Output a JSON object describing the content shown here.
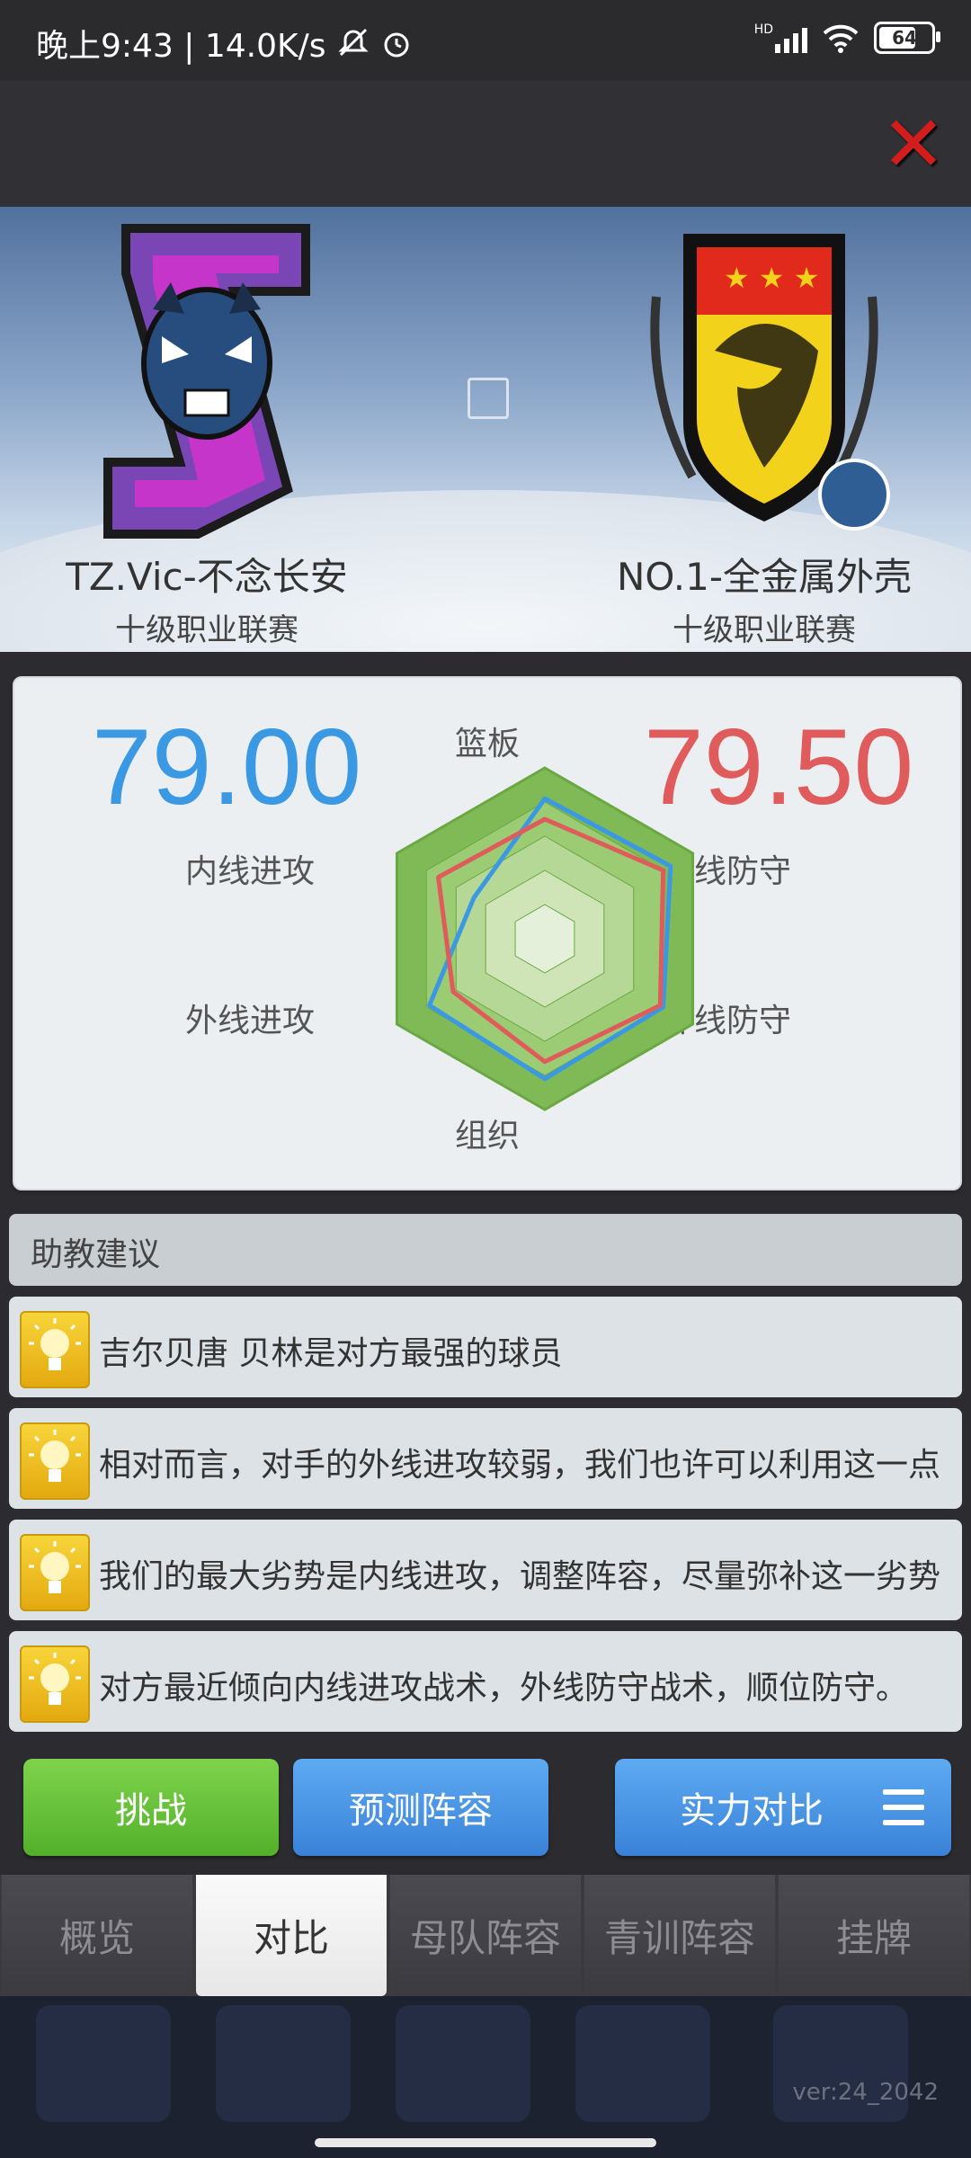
{
  "status_bar": {
    "time_speed": "晚上9:43 | 14.0K/s",
    "network": "HD",
    "battery": "64"
  },
  "header": {
    "close_icon": "close-x-icon"
  },
  "home_team": {
    "name": "TZ.Vic-不念长安",
    "league": "十级职业联赛",
    "score": "79.00",
    "color": "#3b98e3"
  },
  "away_team": {
    "name": "NO.1-全金属外壳",
    "league": "十级职业联赛",
    "score": "79.50",
    "color": "#e05b5b"
  },
  "radar": {
    "axes": [
      "篮板",
      "内线防守",
      "外线防守",
      "组织",
      "外线进攻",
      "内线进攻"
    ],
    "home_values": [
      0.82,
      0.85,
      0.8,
      0.82,
      0.78,
      0.48
    ],
    "away_values": [
      0.7,
      0.8,
      0.78,
      0.72,
      0.62,
      0.72
    ]
  },
  "advice": {
    "title": "助教建议",
    "items": [
      "吉尔贝唐 贝林是对方最强的球员",
      "相对而言，对手的外线进攻较弱，我们也许可以利用这一点",
      "我们的最大劣势是内线进攻，调整阵容，尽量弥补这一劣势",
      "对方最近倾向内线进攻战术，外线防守战术，顺位防守。"
    ]
  },
  "buttons": {
    "challenge": "挑战",
    "predict": "预测阵容",
    "compare": "实力对比"
  },
  "tabs": [
    "概览",
    "对比",
    "母队阵容",
    "青训阵容",
    "挂牌"
  ],
  "version": "ver:24_2042"
}
